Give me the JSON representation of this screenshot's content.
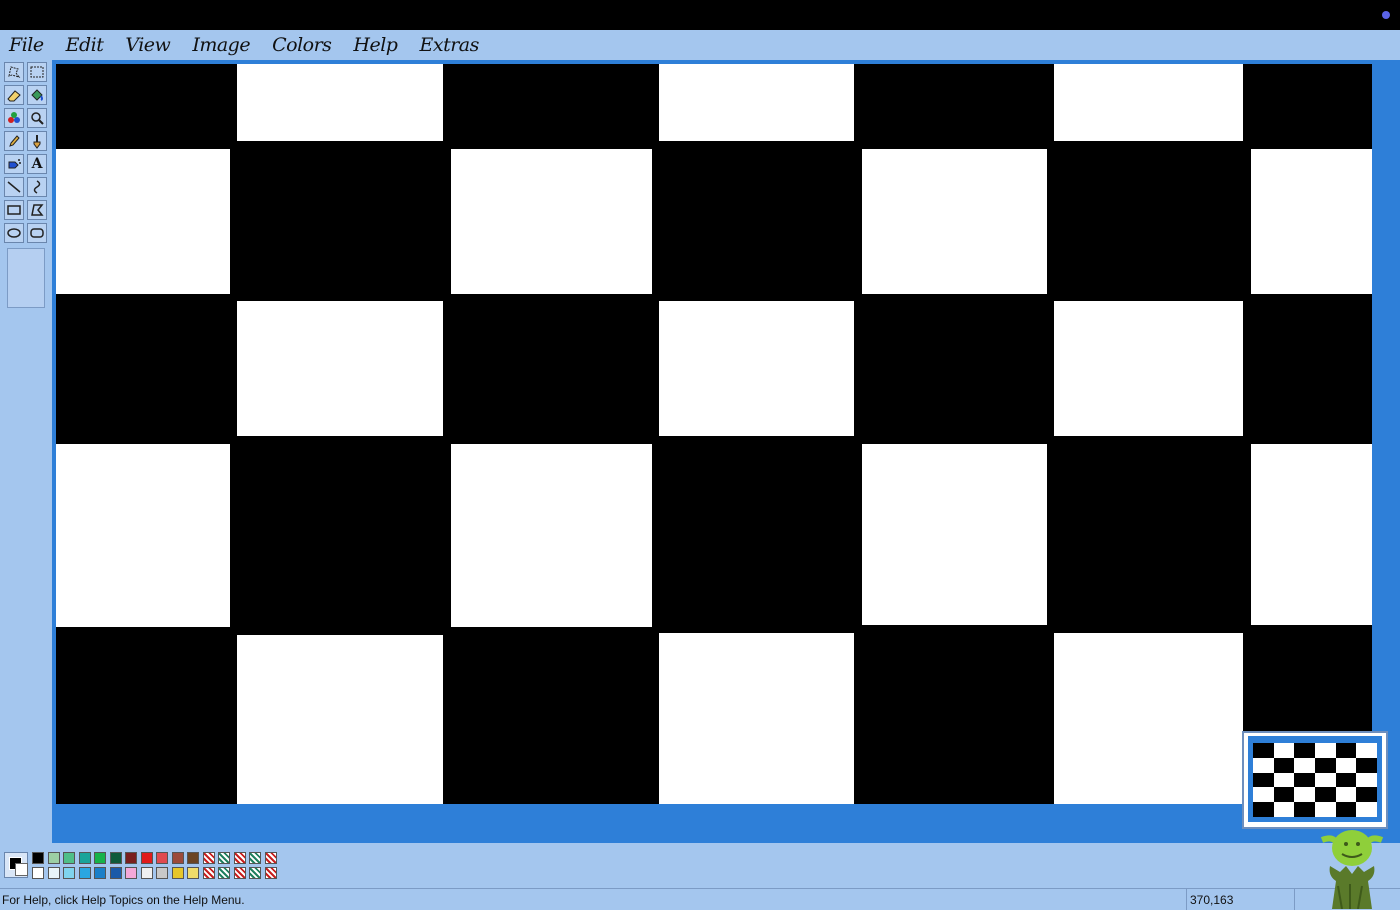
{
  "menubar": {
    "items": [
      "File",
      "Edit",
      "View",
      "Image",
      "Colors",
      "Help",
      "Extras"
    ]
  },
  "toolbox": {
    "tools": [
      {
        "name": "free-form-select-icon"
      },
      {
        "name": "rect-select-icon"
      },
      {
        "name": "eraser-icon"
      },
      {
        "name": "fill-bucket-icon"
      },
      {
        "name": "pick-color-icon"
      },
      {
        "name": "magnifier-icon"
      },
      {
        "name": "pencil-icon"
      },
      {
        "name": "brush-icon"
      },
      {
        "name": "airbrush-icon"
      },
      {
        "name": "text-icon",
        "glyph": "A"
      },
      {
        "name": "line-icon"
      },
      {
        "name": "curve-icon"
      },
      {
        "name": "rectangle-icon"
      },
      {
        "name": "polygon-icon"
      },
      {
        "name": "ellipse-icon"
      },
      {
        "name": "rounded-rectangle-icon"
      }
    ]
  },
  "colors": {
    "foreground": "#000000",
    "background": "#ffffff",
    "workarea": "#2e7fd8",
    "chrome": "#a4c6ee",
    "palette_top": [
      "#000000",
      "#9ccfa4",
      "#4fbf88",
      "#19a49a",
      "#17b24a",
      "#0e5a3a",
      "#7a1f1f",
      "#e01b1b",
      "#e04a50",
      "#9c4a3a",
      "#6b4423",
      "#pattern",
      "#pattern",
      "#pattern",
      "#pattern",
      "#pattern"
    ],
    "palette_bottom": [
      "#ffffff",
      "#e8f4f8",
      "#7fd4ee",
      "#2aa6e0",
      "#1a7fc8",
      "#1a5aa8",
      "#f4a8d8",
      "#f0f0f0",
      "#c8c8c8",
      "#e6c62a",
      "#f0dc6a",
      "#pattern",
      "#pattern",
      "#pattern",
      "#pattern",
      "#pattern"
    ]
  },
  "status": {
    "help_text": "For Help, click Help Topics on the Help Menu.",
    "coordinates": "370,163"
  }
}
